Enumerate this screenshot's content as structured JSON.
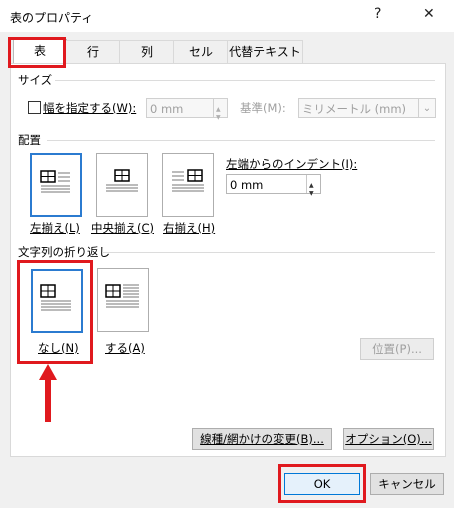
{
  "window": {
    "title": "表のプロパティ",
    "help_glyph": "?",
    "close_glyph": "✕"
  },
  "tabs": [
    {
      "label": "表"
    },
    {
      "label": "行"
    },
    {
      "label": "列"
    },
    {
      "label": "セル"
    },
    {
      "label": "代替テキスト"
    }
  ],
  "size": {
    "heading": "サイズ",
    "width_checkbox_label": "幅を指定する(W):",
    "width_value": "0 mm",
    "basis_label": "基準(M):",
    "basis_value": "ミリメートル (mm)"
  },
  "alignment": {
    "heading": "配置",
    "left_label": "左揃え(L)",
    "center_label": "中央揃え(C)",
    "right_label": "右揃え(H)",
    "indent_label": "左端からのインデント(I):",
    "indent_value": "0 mm"
  },
  "wrapping": {
    "heading": "文字列の折り返し",
    "none_label": "なし(N)",
    "around_label": "する(A)",
    "position_button": "位置(P)..."
  },
  "buttons": {
    "borders": "線種/網かけの変更(B)...",
    "options": "オプション(O)...",
    "ok": "OK",
    "cancel": "キャンセル"
  },
  "colors": {
    "highlight": "#e0191e",
    "selection": "#2b7bd0"
  }
}
